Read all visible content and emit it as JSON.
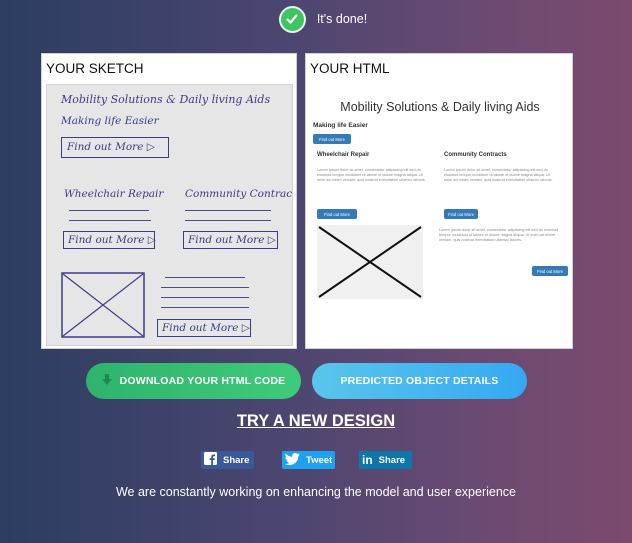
{
  "status": {
    "text": "It's done!"
  },
  "sketch_panel": {
    "title": "YOUR SKETCH",
    "handwriting": {
      "heading": "Mobility Solutions & Daily living Aids",
      "subheading": "Making life Easier",
      "find_out_more": "Find out More ▷",
      "col1_title": "Wheelchair Repair",
      "col2_title": "Community Contracts"
    }
  },
  "html_panel": {
    "title": "YOUR HTML",
    "preview": {
      "heading": "Mobility Solutions & Daily living Aids",
      "subheading": "Making life Easier",
      "top_button": "Find out More",
      "col1_title": "Wheelchair Repair",
      "col2_title": "Community Contracts",
      "lorem": "Lorem ipsum dolor sit amet, consectetur adipiscing elit sed do eiusmod tempor incididunt ut labore et dolore magna aliqua. Ut enim ad minim veniam, quis nostrud exercitation ullamco laboris.",
      "col_button": "Find out More",
      "bottom_button": "Find out More"
    }
  },
  "actions": {
    "download_label": "DOWNLOAD YOUR HTML CODE",
    "details_label": "PREDICTED OBJECT DETAILS",
    "try_new_label": "TRY A NEW DESIGN"
  },
  "share": {
    "facebook": "Share",
    "twitter": "Tweet",
    "linkedin": "Share"
  },
  "footer": {
    "text": "We are constantly working on enhancing the model and user experience"
  },
  "colors": {
    "download": "#2fb36d",
    "details": "#35a8f2",
    "facebook": "#3b5998",
    "twitter": "#1da1f2",
    "linkedin": "#0e76a8",
    "check": "#3fc463"
  }
}
